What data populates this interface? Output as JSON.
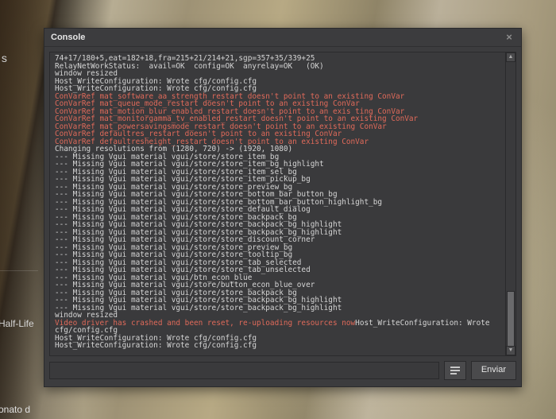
{
  "background": {
    "frag_top": "wns",
    "frag_mid": "Half-Life",
    "frag_bottom": "onato d"
  },
  "console": {
    "title": "Console",
    "close_glyph": "×",
    "submit_label": "Enviar",
    "scroll_up": "▲",
    "scroll_down": "▼",
    "input_value": "",
    "logs": [
      {
        "t": "74+17/180+5,eat=182+18,fra=215+21/214+21,sgp=357+35/339+25",
        "c": "n"
      },
      {
        "t": "RelayNetWorkStatus:  avail=OK  config=OK  anyrelay=OK   (OK)",
        "c": "n"
      },
      {
        "t": "window resized",
        "c": "n"
      },
      {
        "t": "Host_WriteConfiguration: Wrote cfg/config.cfg",
        "c": "n"
      },
      {
        "t": "Host_WriteConfiguration: Wrote cfg/config.cfg",
        "c": "n"
      },
      {
        "t": "ConVarRef mat_software_aa_strength_restart doesn't point to an existing ConVar",
        "c": "e"
      },
      {
        "t": "ConVarRef mat_queue_mode_restart doesn't point to an existing ConVar",
        "c": "e"
      },
      {
        "t": "ConVarRef mat_motion_blur_enabled_restart doesn't point to an exis ting ConVar",
        "c": "e"
      },
      {
        "t": "ConVarRef mat_monitorgamma_tv_enabled_restart doesn't point to an existing ConVar",
        "c": "e"
      },
      {
        "t": "ConVarRef mat_powersavingsmode_restart doesn't point to an existing ConVar",
        "c": "e"
      },
      {
        "t": "ConVarRef defaultres_restart doesn't point to an existing ConVar",
        "c": "e"
      },
      {
        "t": "ConVarRef defaultresheight_restart doesn't point to an existing ConVar",
        "c": "e"
      },
      {
        "t": "Changing resolutions from (1280, 720) -> (1920, 1080)",
        "c": "n"
      },
      {
        "t": "--- Missing Vgui material vgui/store/store_item_bg",
        "c": "n"
      },
      {
        "t": "--- Missing Vgui material vgui/store/store_item_bg_highlight",
        "c": "n"
      },
      {
        "t": "--- Missing Vgui material vgui/store/store_item_sel_bg",
        "c": "n"
      },
      {
        "t": "--- Missing Vgui material vgui/store/store_item_pickup_bg",
        "c": "n"
      },
      {
        "t": "--- Missing Vgui material vgui/store/store_preview_bg",
        "c": "n"
      },
      {
        "t": "--- Missing Vgui material vgui/store/store_bottom_bar_button_bg",
        "c": "n"
      },
      {
        "t": "--- Missing Vgui material vgui/store/store_bottom_bar_button_highlight_bg",
        "c": "n"
      },
      {
        "t": "--- Missing Vgui material vgui/store/store_default_dialog",
        "c": "n"
      },
      {
        "t": "--- Missing Vgui material vgui/store/store_backpack_bg",
        "c": "n"
      },
      {
        "t": "--- Missing Vgui material vgui/store/store_backpack_bg_highlight",
        "c": "n"
      },
      {
        "t": "--- Missing Vgui material vgui/store/store_backpack_bg_highlight",
        "c": "n"
      },
      {
        "t": "--- Missing Vgui material vgui/store/store_discount_corner",
        "c": "n"
      },
      {
        "t": "--- Missing Vgui material vgui/store/store_preview_bg",
        "c": "n"
      },
      {
        "t": "--- Missing Vgui material vgui/store/store_tooltip_bg",
        "c": "n"
      },
      {
        "t": "--- Missing Vgui material vgui/store/store_tab_selected",
        "c": "n"
      },
      {
        "t": "--- Missing Vgui material vgui/store/store_tab_unselected",
        "c": "n"
      },
      {
        "t": "--- Missing Vgui material vgui/btn_econ_blue",
        "c": "n"
      },
      {
        "t": "--- Missing Vgui material vgui/store/button_econ_blue_over",
        "c": "n"
      },
      {
        "t": "--- Missing Vgui material vgui/store/store_backpack_bg",
        "c": "n"
      },
      {
        "t": "--- Missing Vgui material vgui/store/store_backpack_bg_highlight",
        "c": "n"
      },
      {
        "t": "--- Missing Vgui material vgui/store/store_backpack_bg_highlight",
        "c": "n"
      },
      {
        "t": "window resized",
        "c": "n"
      },
      {
        "t": "Video driver has crashed and been reset, re-uploading resources now",
        "c": "e",
        "inline_after": "Host_WriteConfiguration: Wrote "
      },
      {
        "t": "cfg/config.cfg",
        "c": "n"
      },
      {
        "t": "Host_WriteConfiguration: Wrote cfg/config.cfg",
        "c": "n"
      },
      {
        "t": "Host_WriteConfiguration: Wrote cfg/config.cfg",
        "c": "n"
      }
    ]
  }
}
